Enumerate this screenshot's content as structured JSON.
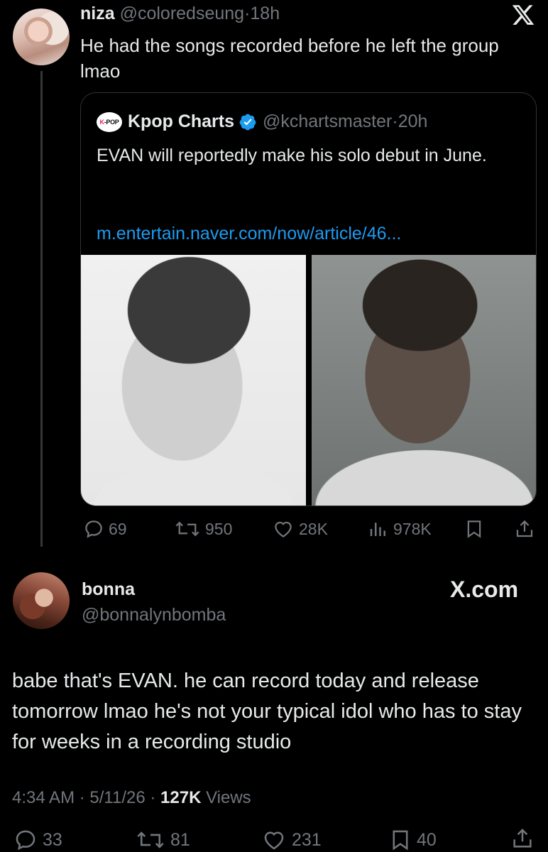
{
  "tweet": {
    "author_name": "niza",
    "author_handle": "@coloredseung",
    "separator": "·",
    "time": "18h",
    "text": "He had the songs recorded before he left the group lmao"
  },
  "quote": {
    "logo_text_k": "K",
    "logo_text_pop": "-POP",
    "author_name": "Kpop Charts",
    "author_handle": "@kchartsmaster",
    "separator": "·",
    "time": "20h",
    "text": "EVAN will reportedly make his solo debut in June.",
    "link": "m.entertain.naver.com/now/article/46..."
  },
  "tweet_actions": {
    "replies": "69",
    "reposts": "950",
    "likes": "28K",
    "views": "978K"
  },
  "reply": {
    "author_name": "bonna",
    "author_handle": "@bonnalynbomba",
    "watermark": "X.com",
    "text": "babe that's EVAN. he can record today and release tomorrow lmao he's not your typical idol who has to stay for weeks in a recording studio",
    "time": "4:34 AM",
    "date": "5/11/26",
    "separator": "·",
    "views_count": "127K",
    "views_label": "Views"
  },
  "reply_actions": {
    "replies": "33",
    "reposts": "81",
    "likes": "231",
    "bookmarks": "40"
  },
  "colors": {
    "background": "#000000",
    "text": "#e7e9ea",
    "muted": "#71767b",
    "link": "#1d9bf0",
    "verified": "#1d9bf0",
    "border": "#2f3336"
  }
}
